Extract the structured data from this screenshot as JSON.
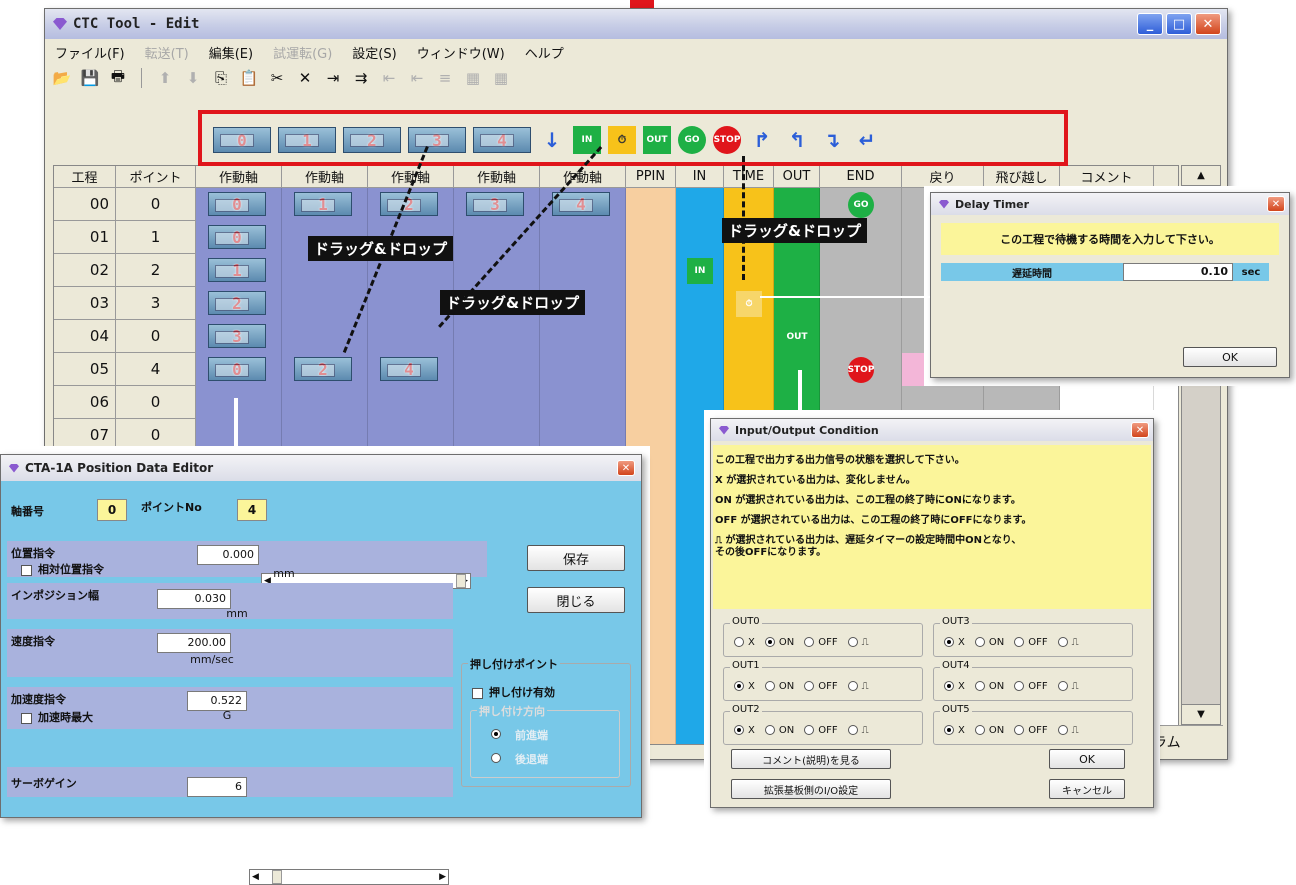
{
  "main": {
    "title": "CTC Tool - Edit",
    "menu": [
      {
        "label": "ファイル(F)",
        "enabled": true
      },
      {
        "label": "転送(T)",
        "enabled": false
      },
      {
        "label": "編集(E)",
        "enabled": true
      },
      {
        "label": "試運転(G)",
        "enabled": false
      },
      {
        "label": "設定(S)",
        "enabled": true
      },
      {
        "label": "ウィンドウ(W)",
        "enabled": true
      },
      {
        "label": "ヘルプ",
        "enabled": true
      }
    ],
    "palette_axes": [
      "0",
      "1",
      "2",
      "3",
      "4"
    ],
    "palette_tools": [
      {
        "name": "pin-down-icon",
        "text": "↓"
      },
      {
        "name": "input-signal-icon",
        "text": "IN"
      },
      {
        "name": "timer-icon",
        "text": "⏱"
      },
      {
        "name": "output-signal-icon",
        "text": "OUT"
      },
      {
        "name": "go-icon",
        "text": "GO"
      },
      {
        "name": "stop-icon",
        "text": "STOP"
      },
      {
        "name": "return-up-icon",
        "text": "↱"
      },
      {
        "name": "return-left-icon",
        "text": "↰"
      },
      {
        "name": "skip-down-icon",
        "text": "↴"
      },
      {
        "name": "skip-left-icon",
        "text": "↵"
      }
    ],
    "columns": [
      "工程",
      "ポイント",
      "作動軸",
      "作動軸",
      "作動軸",
      "作動軸",
      "作動軸",
      "PPIN",
      "IN",
      "TIME",
      "OUT",
      "END",
      "戻り",
      "飛び越し",
      "コメント"
    ],
    "rows": [
      {
        "step": "00",
        "point": "0"
      },
      {
        "step": "01",
        "point": "1"
      },
      {
        "step": "02",
        "point": "2"
      },
      {
        "step": "03",
        "point": "3"
      },
      {
        "step": "04",
        "point": "0"
      },
      {
        "step": "05",
        "point": "4"
      },
      {
        "step": "06",
        "point": "0"
      },
      {
        "step": "07",
        "point": "0"
      }
    ],
    "status_fragment": "ラム"
  },
  "annotations": {
    "drag_drop": "ドラッグ&ドロップ"
  },
  "delay_timer": {
    "title": "Delay Timer",
    "message": "この工程で待機する時間を入力して下さい。",
    "label": "遅延時間",
    "value": "0.10",
    "unit": "sec",
    "ok": "OK"
  },
  "io_condition": {
    "title": "Input/Output Condition",
    "lines": [
      "この工程で出力する出力信号の状態を選択して下さい。",
      "X が選択されている出力は、変化しません。",
      "ON が選択されている出力は、この工程の終了時にONになります。",
      "OFF が選択されている出力は、この工程の終了時にOFFになります。",
      "⎍ が選択されている出力は、遅延タイマーの設定時間中ONとなり、",
      "その後OFFになります。"
    ],
    "outputs": [
      {
        "label": "OUT0",
        "selected": "ON"
      },
      {
        "label": "OUT3",
        "selected": "X"
      },
      {
        "label": "OUT1",
        "selected": "X"
      },
      {
        "label": "OUT4",
        "selected": "X"
      },
      {
        "label": "OUT2",
        "selected": "X"
      },
      {
        "label": "OUT5",
        "selected": "X"
      }
    ],
    "options": [
      "X",
      "ON",
      "OFF",
      "⎍"
    ],
    "comment_btn": "コメント(説明)を見る",
    "ext_btn": "拡張基板側のI/O設定",
    "ok": "OK",
    "cancel": "キャンセル"
  },
  "position_editor": {
    "title": "CTA-1A Position Data Editor",
    "axis_label": "軸番号",
    "axis_value": "0",
    "point_label": "ポイントNo",
    "point_value": "4",
    "position_label": "位置指令",
    "position_value": "0.000",
    "position_unit": "mm",
    "relative_label": "相対位置指令",
    "inpos_label": "インポジション幅",
    "inpos_value": "0.030",
    "inpos_unit": "mm",
    "speed_label": "速度指令",
    "speed_value": "200.00",
    "speed_unit": "mm/sec",
    "accel_label": "加速度指令",
    "accel_value": "0.522",
    "accel_unit": "G",
    "accel_max_label": "加速時最大",
    "servo_label": "サーボゲイン",
    "servo_value": "6",
    "save": "保存",
    "close": "閉じる",
    "push_group": "押し付けポイント",
    "push_enable": "押し付け有効",
    "push_dir_group": "押し付け方向",
    "push_dir_a": "前進端",
    "push_dir_b": "後退端"
  },
  "colors": {
    "axis_col": "#8a92d0",
    "ppin_col": "#f7cfa0",
    "in_col": "#1fa8e8",
    "time_col": "#f7c21a",
    "out_col": "#1eb045",
    "highlight": "#e0151b",
    "editor_bg": "#78c8e8",
    "yellow_msg": "#fbf59a"
  }
}
